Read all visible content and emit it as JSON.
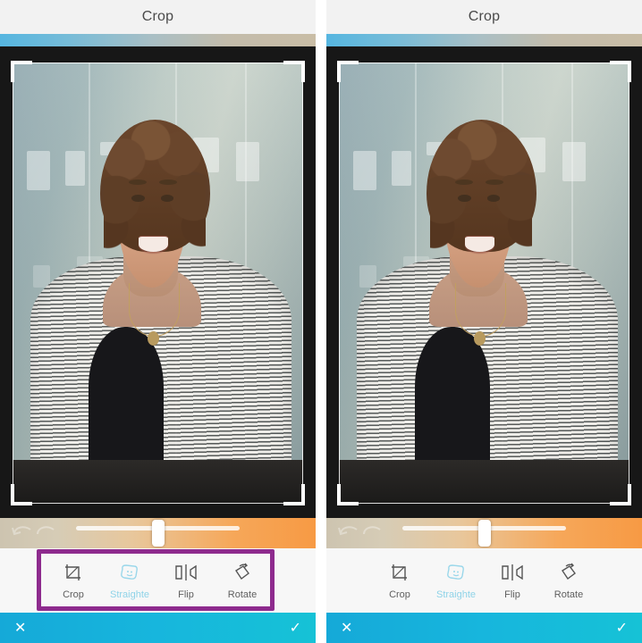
{
  "app": {
    "screens": [
      {
        "id": "left-screen",
        "header": {
          "title": "Crop"
        },
        "straighten_slider": {
          "name": "straighten-slider",
          "value_percent": 50,
          "track_fill_percent": 52
        },
        "toolbar": {
          "highlighted": true,
          "highlight_color": "#8e2b8e",
          "items": [
            {
              "icon": "crop-icon",
              "label": "Crop",
              "active": false
            },
            {
              "icon": "straighten-icon",
              "label": "Straighte",
              "active": true
            },
            {
              "icon": "flip-icon",
              "label": "Flip",
              "active": false
            },
            {
              "icon": "rotate-icon",
              "label": "Rotate",
              "active": false
            }
          ]
        },
        "action_bar": {
          "cancel_label": "✕",
          "confirm_label": "✓",
          "background_color": "#16b4da"
        }
      },
      {
        "id": "right-screen",
        "header": {
          "title": "Crop"
        },
        "straighten_slider": {
          "name": "straighten-slider",
          "value_percent": 50,
          "track_fill_percent": 52
        },
        "toolbar": {
          "highlighted": false,
          "highlight_color": "#8e2b8e",
          "items": [
            {
              "icon": "crop-icon",
              "label": "Crop",
              "active": false
            },
            {
              "icon": "straighten-icon",
              "label": "Straighte",
              "active": true
            },
            {
              "icon": "flip-icon",
              "label": "Flip",
              "active": false
            },
            {
              "icon": "rotate-icon",
              "label": "Rotate",
              "active": false
            }
          ]
        },
        "action_bar": {
          "cancel_label": "✕",
          "confirm_label": "✓",
          "background_color": "#16b4da"
        }
      }
    ],
    "photo": {
      "description": "Portrait of a smiling woman with short curly brown hair wearing a striped cardigan over a black top, in front of an office glass wall",
      "crop_frame": {
        "handles": [
          "top-left",
          "top-right",
          "bottom-left",
          "bottom-right"
        ]
      }
    },
    "colors": {
      "accent_teal": "#16b4da",
      "highlight_purple": "#8e2b8e",
      "active_label": "#8fd3e8",
      "label": "#5f5f5f",
      "stage_background": "#171717"
    }
  }
}
